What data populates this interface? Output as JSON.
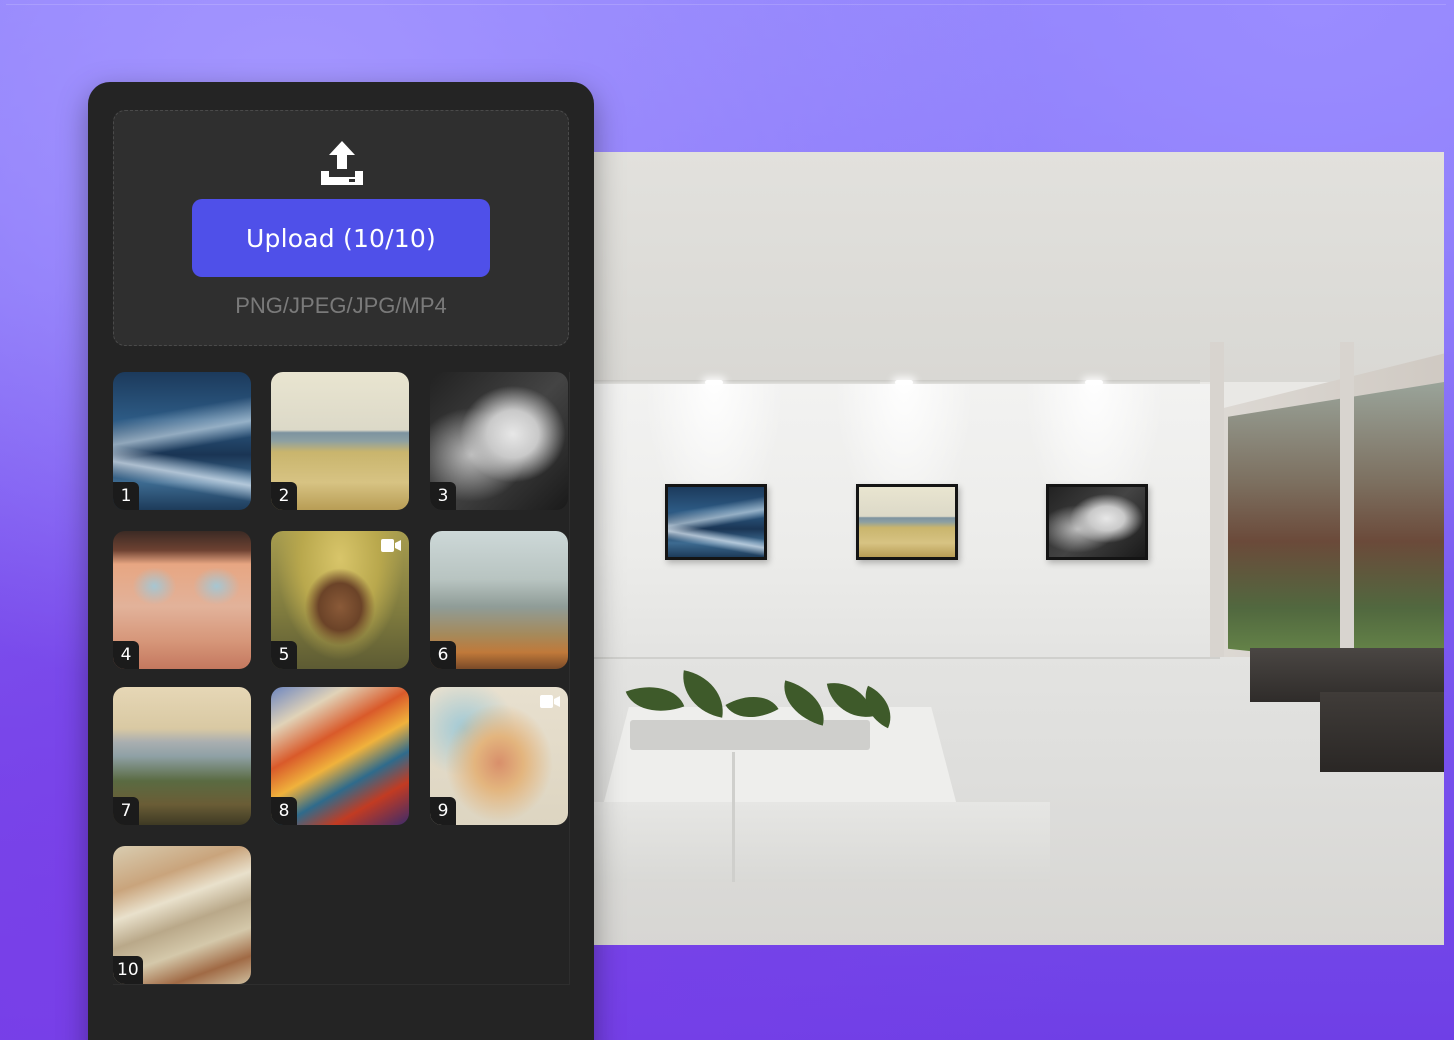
{
  "upload": {
    "button_label": "Upload (10/10)",
    "formats": "PNG/JPEG/JPG/MP4"
  },
  "thumbnails": [
    {
      "number": "1",
      "is_video": false
    },
    {
      "number": "2",
      "is_video": false
    },
    {
      "number": "3",
      "is_video": false
    },
    {
      "number": "4",
      "is_video": false
    },
    {
      "number": "5",
      "is_video": true
    },
    {
      "number": "6",
      "is_video": false
    },
    {
      "number": "7",
      "is_video": false
    },
    {
      "number": "8",
      "is_video": false
    },
    {
      "number": "9",
      "is_video": true
    },
    {
      "number": "10",
      "is_video": false
    }
  ],
  "colors": {
    "accent": "#4f50e9",
    "panel": "#242424",
    "dropzone": "#2f2f2f",
    "background": "#7f63f3"
  },
  "icons": {
    "upload": "upload-tray-icon",
    "video": "video-camera-icon"
  }
}
